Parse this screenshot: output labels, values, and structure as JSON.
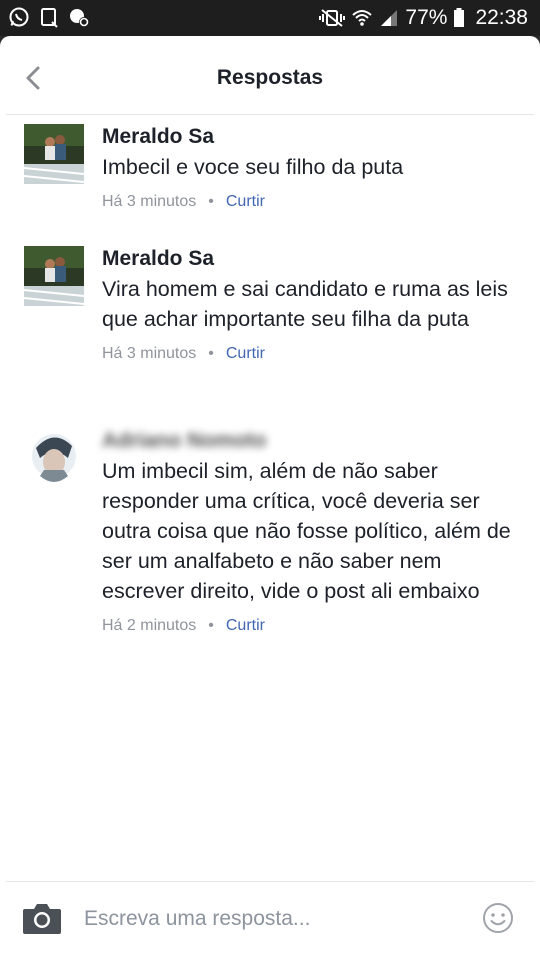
{
  "status_bar": {
    "battery_percent": "77%",
    "time": "22:38",
    "left_icons": [
      "whatsapp-icon",
      "notification-icon",
      "settings-notification-icon"
    ],
    "right_icons": [
      "vibrate-icon",
      "wifi-icon",
      "signal-icon",
      "battery-icon"
    ]
  },
  "header": {
    "title": "Respostas",
    "back_icon": "chevron-left-icon"
  },
  "comments": [
    {
      "author": "Meraldo Sa",
      "text": "Imbecil e voce seu filho da puta",
      "time": "Há 3 minutos",
      "like_label": "Curtir",
      "separator": "•"
    },
    {
      "author": "Meraldo Sa",
      "text": "Vira homem e sai candidato e ruma as leis que achar importante seu filha da puta",
      "time": "Há 3 minutos",
      "like_label": "Curtir",
      "separator": "•"
    },
    {
      "author": "Adriano Nomoto",
      "text": "Um imbecil sim, além de não saber responder uma crítica, você deveria ser outra coisa que não fosse político, além de ser um analfabeto e não saber nem escrever direito, vide o post ali embaixo",
      "time": "Há 2 minutos",
      "like_label": "Curtir",
      "separator": "•"
    }
  ],
  "composer": {
    "placeholder": "Escreva uma resposta...",
    "camera_icon": "camera-icon",
    "emoji_icon": "emoji-icon"
  },
  "colors": {
    "text_primary": "#1d2129",
    "text_secondary": "#90949c",
    "link": "#4267b2",
    "status_bar": "#1e1e1e"
  }
}
